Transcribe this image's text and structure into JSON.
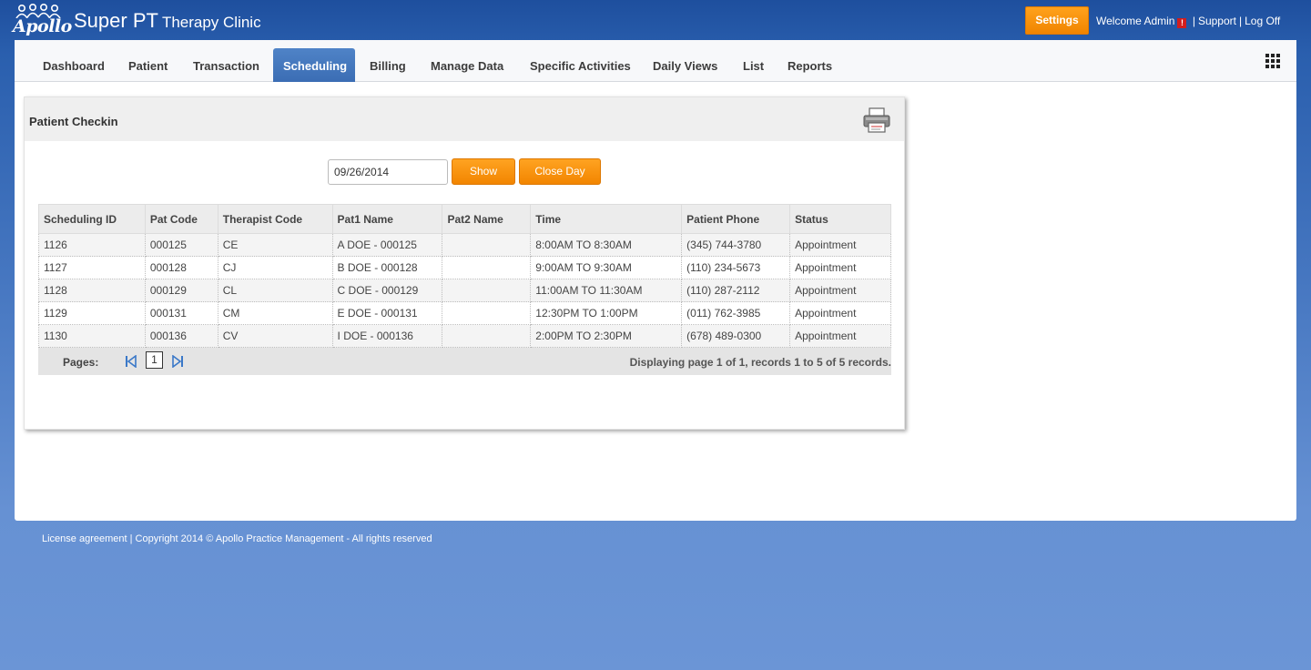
{
  "header": {
    "logo_text": "Apollo",
    "clinic_name_big": "Super PT",
    "clinic_name_small": "Therapy Clinic",
    "settings_label": "Settings",
    "welcome_text": "Welcome Admin",
    "alert_badge": "!",
    "support_label": "Support",
    "logoff_label": "Log Off"
  },
  "nav": {
    "tabs": [
      {
        "label": "Dashboard"
      },
      {
        "label": "Patient"
      },
      {
        "label": "Transaction"
      },
      {
        "label": "Scheduling"
      },
      {
        "label": "Billing"
      },
      {
        "label": "Manage Data"
      },
      {
        "label": "Specific Activities"
      },
      {
        "label": "Daily Views"
      },
      {
        "label": "List"
      },
      {
        "label": "Reports"
      }
    ],
    "active_tab": "Scheduling",
    "menu_icon": "grid-icon"
  },
  "panel": {
    "title": "Patient Checkin",
    "print_icon": "printer-icon",
    "date_value": "09/26/2014",
    "show_label": "Show",
    "close_day_label": "Close Day"
  },
  "table": {
    "columns": [
      "Scheduling ID",
      "Pat Code",
      "Therapist Code",
      "Pat1 Name",
      "Pat2 Name",
      "Time",
      "Patient Phone",
      "Status"
    ],
    "rows": [
      [
        "1126",
        "000125",
        "CE",
        "A DOE - 000125",
        "",
        "8:00AM TO 8:30AM",
        "(345) 744-3780",
        "Appointment"
      ],
      [
        "1127",
        "000128",
        "CJ",
        "B DOE - 000128",
        "",
        "9:00AM TO 9:30AM",
        "(110) 234-5673",
        "Appointment"
      ],
      [
        "1128",
        "000129",
        "CL",
        "C DOE - 000129",
        "",
        "11:00AM TO 11:30AM",
        "(110) 287-2112",
        "Appointment"
      ],
      [
        "1129",
        "000131",
        "CM",
        "E DOE - 000131",
        "",
        "12:30PM TO 1:00PM",
        "(011) 762-3985",
        "Appointment"
      ],
      [
        "1130",
        "000136",
        "CV",
        "I DOE - 000136",
        "",
        "2:00PM TO 2:30PM",
        "(678) 489-0300",
        "Appointment"
      ]
    ]
  },
  "pager": {
    "label": "Pages:",
    "current_page": "1",
    "info": "Displaying page 1 of 1, records 1 to 5 of 5 records."
  },
  "footer": {
    "text": "License agreement | Copyright 2014 © Apollo Practice Management - All rights reserved"
  },
  "colors": {
    "accent_orange": "#f28500",
    "tab_active_blue": "#3b6db4",
    "background_blue": "#2a5fae"
  }
}
